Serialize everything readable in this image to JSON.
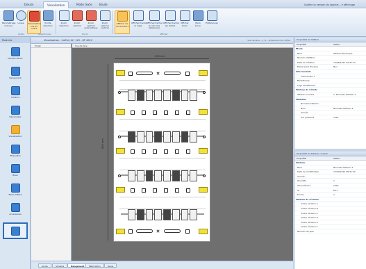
{
  "ribbon": {
    "tabs": [
      "Dessin",
      "Visualisation",
      "Mode texte",
      "Etude"
    ],
    "active_tab": "Visualisation",
    "right_text": "Quitter la version du logiciel...   ▾ affichage",
    "buttons": [
      {
        "label": "Paramétrage manuel"
      },
      {
        "label": "Loupe"
      },
      {
        "label": "Visualisation vue du cadre"
      },
      {
        "label": "Pointe sélection"
      },
      {
        "label": "Zoom sélection"
      },
      {
        "label": "Zoom optimal"
      },
      {
        "label": "Zoom optimal automatique"
      },
      {
        "label": "Zoom optimal vertical"
      },
      {
        "label": "Afficher les conducteurs"
      },
      {
        "label": "Afficher/Cacher la règle"
      },
      {
        "label": "Afficher/Cacher la cote des références"
      },
      {
        "label": "Afficher/Cacher les textes"
      },
      {
        "label": "Afficher écran"
      },
      {
        "label": "Plein écran"
      },
      {
        "label": "Préférences"
      }
    ],
    "groups": [
      "Outils",
      "Sélectionner",
      "Zoom",
      "Afficher"
    ]
  },
  "leftnav": {
    "title": "Modules",
    "items": [
      {
        "label": "Nomenclature"
      },
      {
        "label": "Rangement"
      },
      {
        "label": "Schéma"
      },
      {
        "label": "Développer"
      },
      {
        "label": "Visualisation"
      },
      {
        "label": "Etiquettes"
      },
      {
        "label": "Bilan"
      },
      {
        "label": "Bloqs Affaire"
      },
      {
        "label": "Accessoires"
      },
      {
        "label": ""
      }
    ]
  },
  "document": {
    "title": "Visualisation : Coffret XL³ 125 - 8P 4020",
    "right_text": "Vue de face - 1 / 1 - Dimension du coffret",
    "tree_header": "Projet",
    "view_header": "Vue de face",
    "width_dim": "450 mm",
    "height_dim": "600 mm",
    "bottom_tabs": [
      "Accès",
      "Schéma",
      "Rangement",
      "Fabrication",
      "Devis"
    ],
    "active_bottom_tab": "Rangement"
  },
  "props_top": {
    "title": "Propriétés de l'affaire",
    "col_name": "Propriété",
    "col_value": "Valeur",
    "rows": [
      {
        "k": "Etude",
        "v": "",
        "type": "sec"
      },
      {
        "k": "Nom",
        "v": "Tableau électrique",
        "type": ""
      },
      {
        "k": "Numéro d'affaire",
        "v": "",
        "type": ""
      },
      {
        "k": "Date de création",
        "v": "14/06/2011 09:47:13",
        "type": ""
      },
      {
        "k": "Mode Géné Envelop.",
        "v": "Non",
        "type": ""
      },
      {
        "k": "Intervenants",
        "v": "",
        "type": "sec"
      },
      {
        "k": "Intervenant 1",
        "v": "",
        "type": "sub"
      },
      {
        "k": "Bénéficiaire",
        "v": "",
        "type": ""
      },
      {
        "k": "Logo bénéficiaire",
        "v": "",
        "type": ""
      },
      {
        "k": "Tableau de l'étude",
        "v": "",
        "type": "sec"
      },
      {
        "k": "Tableau courant",
        "v": "1. Nouveau tableau 1",
        "type": ""
      },
      {
        "k": "Tableaux",
        "v": "",
        "type": "sec"
      },
      {
        "k": "Nouveau tableau",
        "v": "",
        "type": "sub"
      },
      {
        "k": "Nom",
        "v": "Nouveau tableau 1",
        "type": "sub"
      },
      {
        "k": "Arrivée",
        "v": "",
        "type": "sub"
      },
      {
        "k": "ICC présumé",
        "v": "10kA",
        "type": "sub"
      }
    ]
  },
  "props_bottom": {
    "title": "Propriétés du tableau courant",
    "col_name": "Propriété",
    "col_value": "Valeur",
    "rows": [
      {
        "k": "Tableau",
        "v": "",
        "type": "sec"
      },
      {
        "k": "Nom",
        "v": "Nouveau tableau 1",
        "type": ""
      },
      {
        "k": "Date de modification",
        "v": "15/03/2012 08:31:32",
        "type": ""
      },
      {
        "k": "Arrivée",
        "v": "",
        "type": ""
      },
      {
        "k": "Quantité",
        "v": "1",
        "type": ""
      },
      {
        "k": "ICC présumé",
        "v": "10kA",
        "type": ""
      },
      {
        "k": "IS",
        "v": "D21",
        "type": ""
      },
      {
        "k": "Forme",
        "v": "1",
        "type": ""
      },
      {
        "k": "Tableau de révision",
        "v": "",
        "type": "sec"
      },
      {
        "k": "Indice révision A",
        "v": "",
        "type": "sub"
      },
      {
        "k": "Indice révision B",
        "v": "",
        "type": "sub"
      },
      {
        "k": "Indice révision C",
        "v": "",
        "type": "sub"
      },
      {
        "k": "Indice révision D",
        "v": "",
        "type": "sub"
      },
      {
        "k": "Indice révision E",
        "v": "",
        "type": "sub"
      },
      {
        "k": "Indice révision F",
        "v": "",
        "type": "sub"
      },
      {
        "k": "Numéro de plan",
        "v": "",
        "type": ""
      }
    ]
  },
  "colors": {
    "accent": "#2f6db8",
    "selected": "#f2b134",
    "terminal": "#f1e23a"
  }
}
